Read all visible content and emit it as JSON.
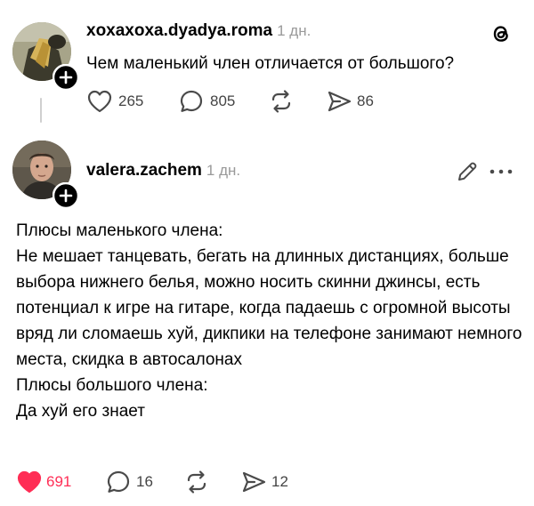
{
  "post1": {
    "username": "xoxaxoxa.dyadya.roma",
    "time": "1 дн.",
    "text": "Чем маленький член отличается от большого?",
    "likes": "265",
    "comments": "805",
    "shares": "86",
    "liked": false
  },
  "post2": {
    "username": "valera.zachem",
    "time": "1 дн.",
    "body": [
      "Плюсы маленького члена:",
      "Не мешает танцевать, бегать на длинных дистанциях, больше выбора нижнего белья, можно носить скинни джинсы, есть потенциал к игре на гитаре, когда падаешь с огромной высоты вряд ли сломаешь хуй, дикпики на телефоне занимают немного места, скидка в автосалонах",
      "Плюсы большого члена:",
      "Да хуй его знает"
    ],
    "likes": "691",
    "comments": "16",
    "shares": "12",
    "liked": true
  },
  "icons": {
    "app_logo": "threads-logo-icon",
    "follow": "plus-circle-icon",
    "like": "heart-icon",
    "comment": "speech-bubble-icon",
    "repost": "repost-icon",
    "share": "paper-plane-icon",
    "edit": "pencil-icon",
    "more": "ellipsis-icon"
  },
  "colors": {
    "text": "#000000",
    "muted": "#9a9a9a",
    "icon": "#4a4a4a",
    "like_red": "#ff2d55",
    "thread_line": "#cfcfcf"
  }
}
